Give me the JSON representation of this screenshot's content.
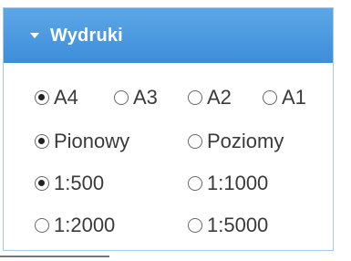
{
  "panel": {
    "title": "Wydruki"
  },
  "format": {
    "options": [
      "A4",
      "A3",
      "A2",
      "A1"
    ],
    "selected": "A4"
  },
  "orientation": {
    "options": [
      "Pionowy",
      "Poziomy"
    ],
    "selected": "Pionowy"
  },
  "scale": {
    "options": [
      "1:500",
      "1:1000",
      "1:2000",
      "1:5000"
    ],
    "selected": "1:500"
  }
}
